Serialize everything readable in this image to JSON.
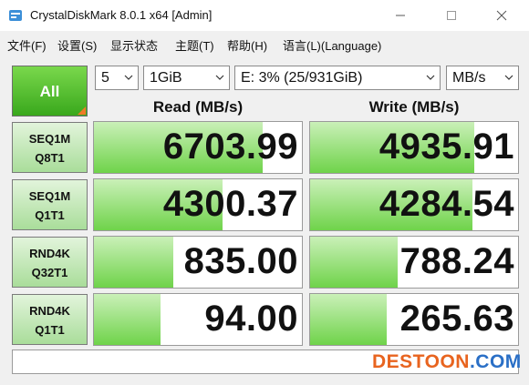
{
  "window": {
    "title": "CrystalDiskMark 8.0.1 x64 [Admin]"
  },
  "menu": [
    "文件(F)",
    "设置(S)",
    "显示状态",
    "主题(T)",
    "帮助(H)",
    "语言(L)(Language)"
  ],
  "controls": {
    "all_label": "All",
    "count": "5",
    "size": "1GiB",
    "drive": "E: 3% (25/931GiB)",
    "unit": "MB/s"
  },
  "headers": {
    "read": "Read (MB/s)",
    "write": "Write (MB/s)"
  },
  "rows": [
    {
      "l1": "SEQ1M",
      "l2": "Q8T1",
      "read": "6703.99",
      "write": "4935.91",
      "read_fill": 0.81,
      "write_fill": 0.79
    },
    {
      "l1": "SEQ1M",
      "l2": "Q1T1",
      "read": "4300.37",
      "write": "4284.54",
      "read_fill": 0.62,
      "write_fill": 0.78
    },
    {
      "l1": "RND4K",
      "l2": "Q32T1",
      "read": "835.00",
      "write": "788.24",
      "read_fill": 0.38,
      "write_fill": 0.42
    },
    {
      "l1": "RND4K",
      "l2": "Q1T1",
      "read": "94.00",
      "write": "265.63",
      "read_fill": 0.32,
      "write_fill": 0.37
    }
  ],
  "status": "",
  "watermark": {
    "part1": "DESTOON",
    "part2": ".COM"
  },
  "colors": {
    "accent_green": "#39a81c",
    "bar_green": "#6fd34a",
    "corner_orange": "#f07a28"
  }
}
